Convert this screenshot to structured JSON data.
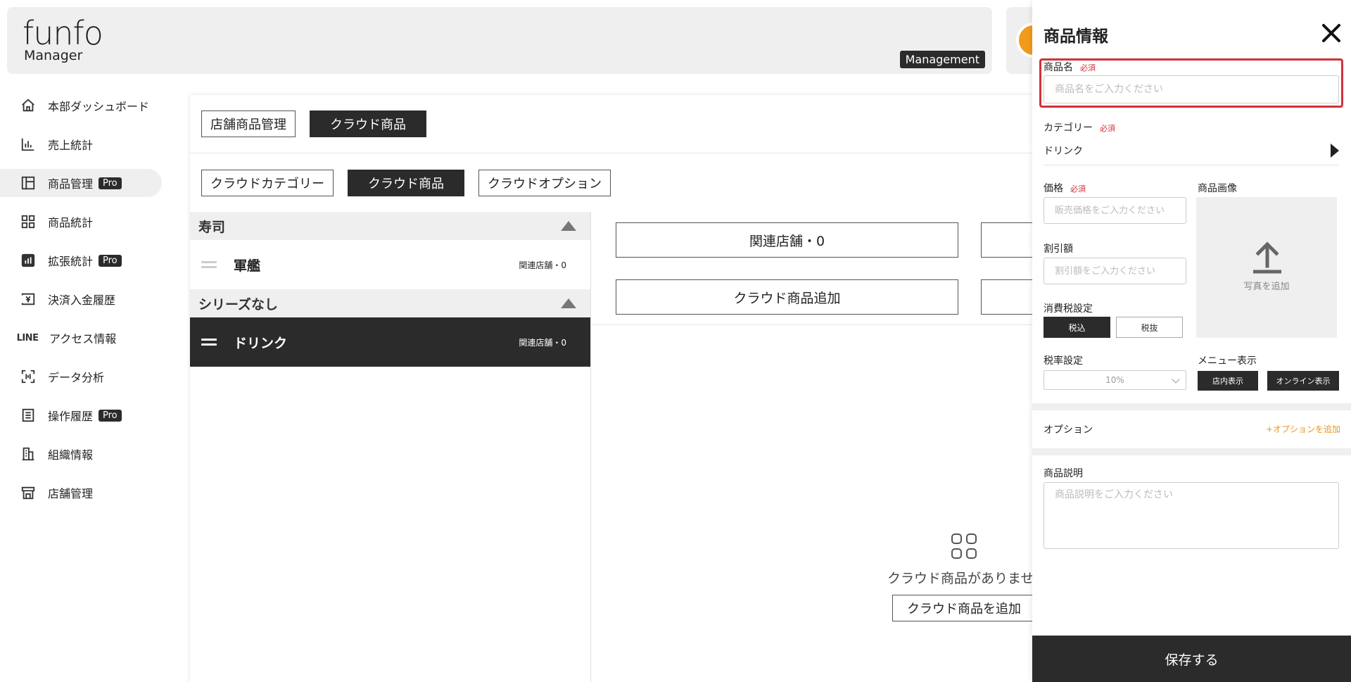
{
  "header": {
    "logo_top": "funfo",
    "logo_bottom": "Manager",
    "badge": "Management"
  },
  "sidebar": {
    "items": [
      {
        "label": "本部ダッシュボード"
      },
      {
        "label": "売上統計"
      },
      {
        "label": "商品管理",
        "badge": "Pro"
      },
      {
        "label": "商品統計"
      },
      {
        "label": "拡張統計",
        "badge": "Pro"
      },
      {
        "label": "決済入金履歴"
      },
      {
        "label": "アクセス情報",
        "icon_text": "LINE"
      },
      {
        "label": "データ分析"
      },
      {
        "label": "操作履歴",
        "badge": "Pro"
      },
      {
        "label": "組織情報"
      },
      {
        "label": "店舗管理"
      }
    ]
  },
  "main": {
    "top_tabs": [
      "店舗商品管理",
      "クラウド商品"
    ],
    "sub_tabs": [
      "クラウドカテゴリー",
      "クラウド商品",
      "クラウドオプション"
    ],
    "series": [
      {
        "title": "寿司",
        "categories": [
          {
            "name": "軍艦",
            "count": "関連店舗・0"
          }
        ]
      },
      {
        "title": "シリーズなし",
        "categories": [
          {
            "name": "ドリンク",
            "count": "関連店舗・0"
          }
        ]
      }
    ],
    "related_stores_btn": "関連店舗・0",
    "add_cloud_product_btn": "クラウド商品追加",
    "empty_text": "クラウド商品がありません",
    "empty_add_btn": "クラウド商品を追加"
  },
  "drawer": {
    "title": "商品情報",
    "required": "必須",
    "name_label": "商品名",
    "name_placeholder": "商品名をご入力ください",
    "category_label": "カテゴリー",
    "category_value": "ドリンク",
    "price_label": "価格",
    "price_placeholder": "販売価格をご入力ください",
    "image_label": "商品画像",
    "image_add": "写真を追加",
    "discount_label": "割引額",
    "discount_placeholder": "割引額をご入力ください",
    "tax_label": "消費税設定",
    "tax_options": [
      "税込",
      "税抜"
    ],
    "rate_label": "税率設定",
    "rate_value": "10%",
    "menu_label": "メニュー表示",
    "menu_options": [
      "店内表示",
      "オンライン表示"
    ],
    "option_label": "オプション",
    "option_add": "+オプションを追加",
    "desc_label": "商品説明",
    "desc_placeholder": "商品説明をご入力ください",
    "save": "保存する"
  },
  "colors": {
    "dark": "#2b2b2b",
    "required_red": "#d0323a",
    "accent_orange": "#e8951f",
    "panel_gray": "#efefef"
  }
}
